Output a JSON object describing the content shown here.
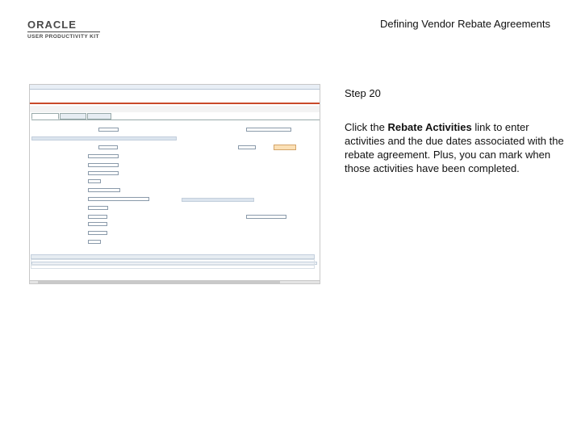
{
  "header": {
    "logo_word": "ORACLE",
    "logo_sub": "USER PRODUCTIVITY KIT",
    "doc_title": "Defining Vendor Rebate Agreements"
  },
  "step": {
    "title": "Step 20",
    "body_before": "Click the ",
    "body_bold": "Rebate Activities",
    "body_after": " link to enter activities and the due dates associated with the rebate agreement. Plus, you can mark when those activities have been completed."
  },
  "colors": {
    "oracle_red": "#c74634",
    "text": "#111111"
  }
}
